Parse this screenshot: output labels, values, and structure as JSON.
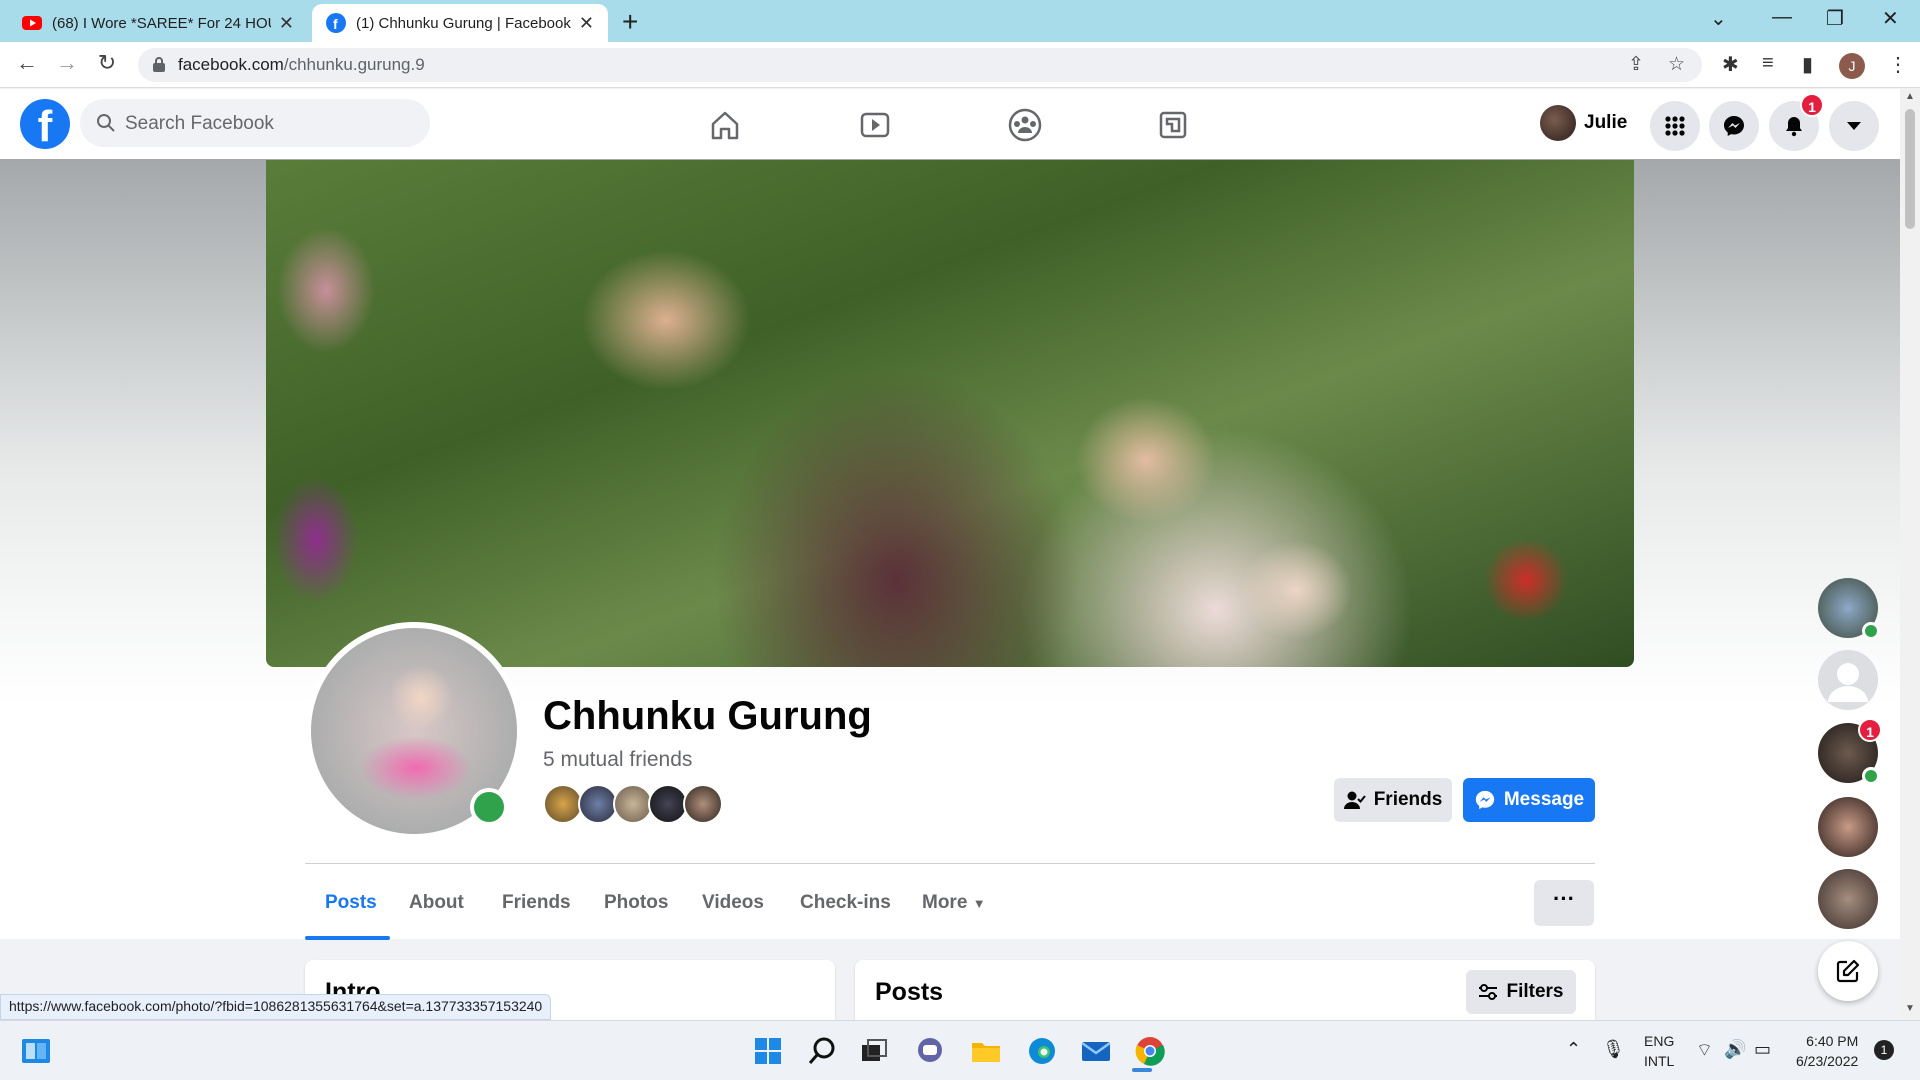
{
  "browser": {
    "tabs": [
      {
        "title": "(68) I Wore *SAREE* For 24 HOUR",
        "icon": "youtube-icon",
        "active": false
      },
      {
        "title": "(1) Chhunku Gurung | Facebook",
        "icon": "facebook-icon",
        "active": true
      }
    ],
    "url_domain": "facebook.com",
    "url_path": "/chhunku.gurung.9",
    "profile_initial": "J"
  },
  "fb_header": {
    "logo": "f",
    "search_placeholder": "Search Facebook",
    "user_name": "Julie",
    "notification_count": "1"
  },
  "profile": {
    "name": "Chhunku Gurung",
    "mutual_friends": "5 mutual friends",
    "friends_button": "Friends",
    "message_button": "Message",
    "tabs": [
      "Posts",
      "About",
      "Friends",
      "Photos",
      "Videos",
      "Check-ins",
      "More"
    ],
    "active_tab": "Posts",
    "more_options": "···"
  },
  "sections": {
    "intro_title": "Intro",
    "posts_title": "Posts",
    "filters_button": "Filters"
  },
  "contacts": {
    "unread_badge": "1"
  },
  "status_bar_url": "https://www.facebook.com/photo/?fbid=1086281355631764&set=a.137733357153240",
  "taskbar": {
    "lang_line1": "ENG",
    "lang_line2": "INTL",
    "time": "6:40 PM",
    "date": "6/23/2022",
    "notifications": "1"
  },
  "colors": {
    "brand": "#1877f2",
    "online": "#31a24c",
    "badge": "#e41e3f",
    "tab_strip": "#a8dcea"
  }
}
